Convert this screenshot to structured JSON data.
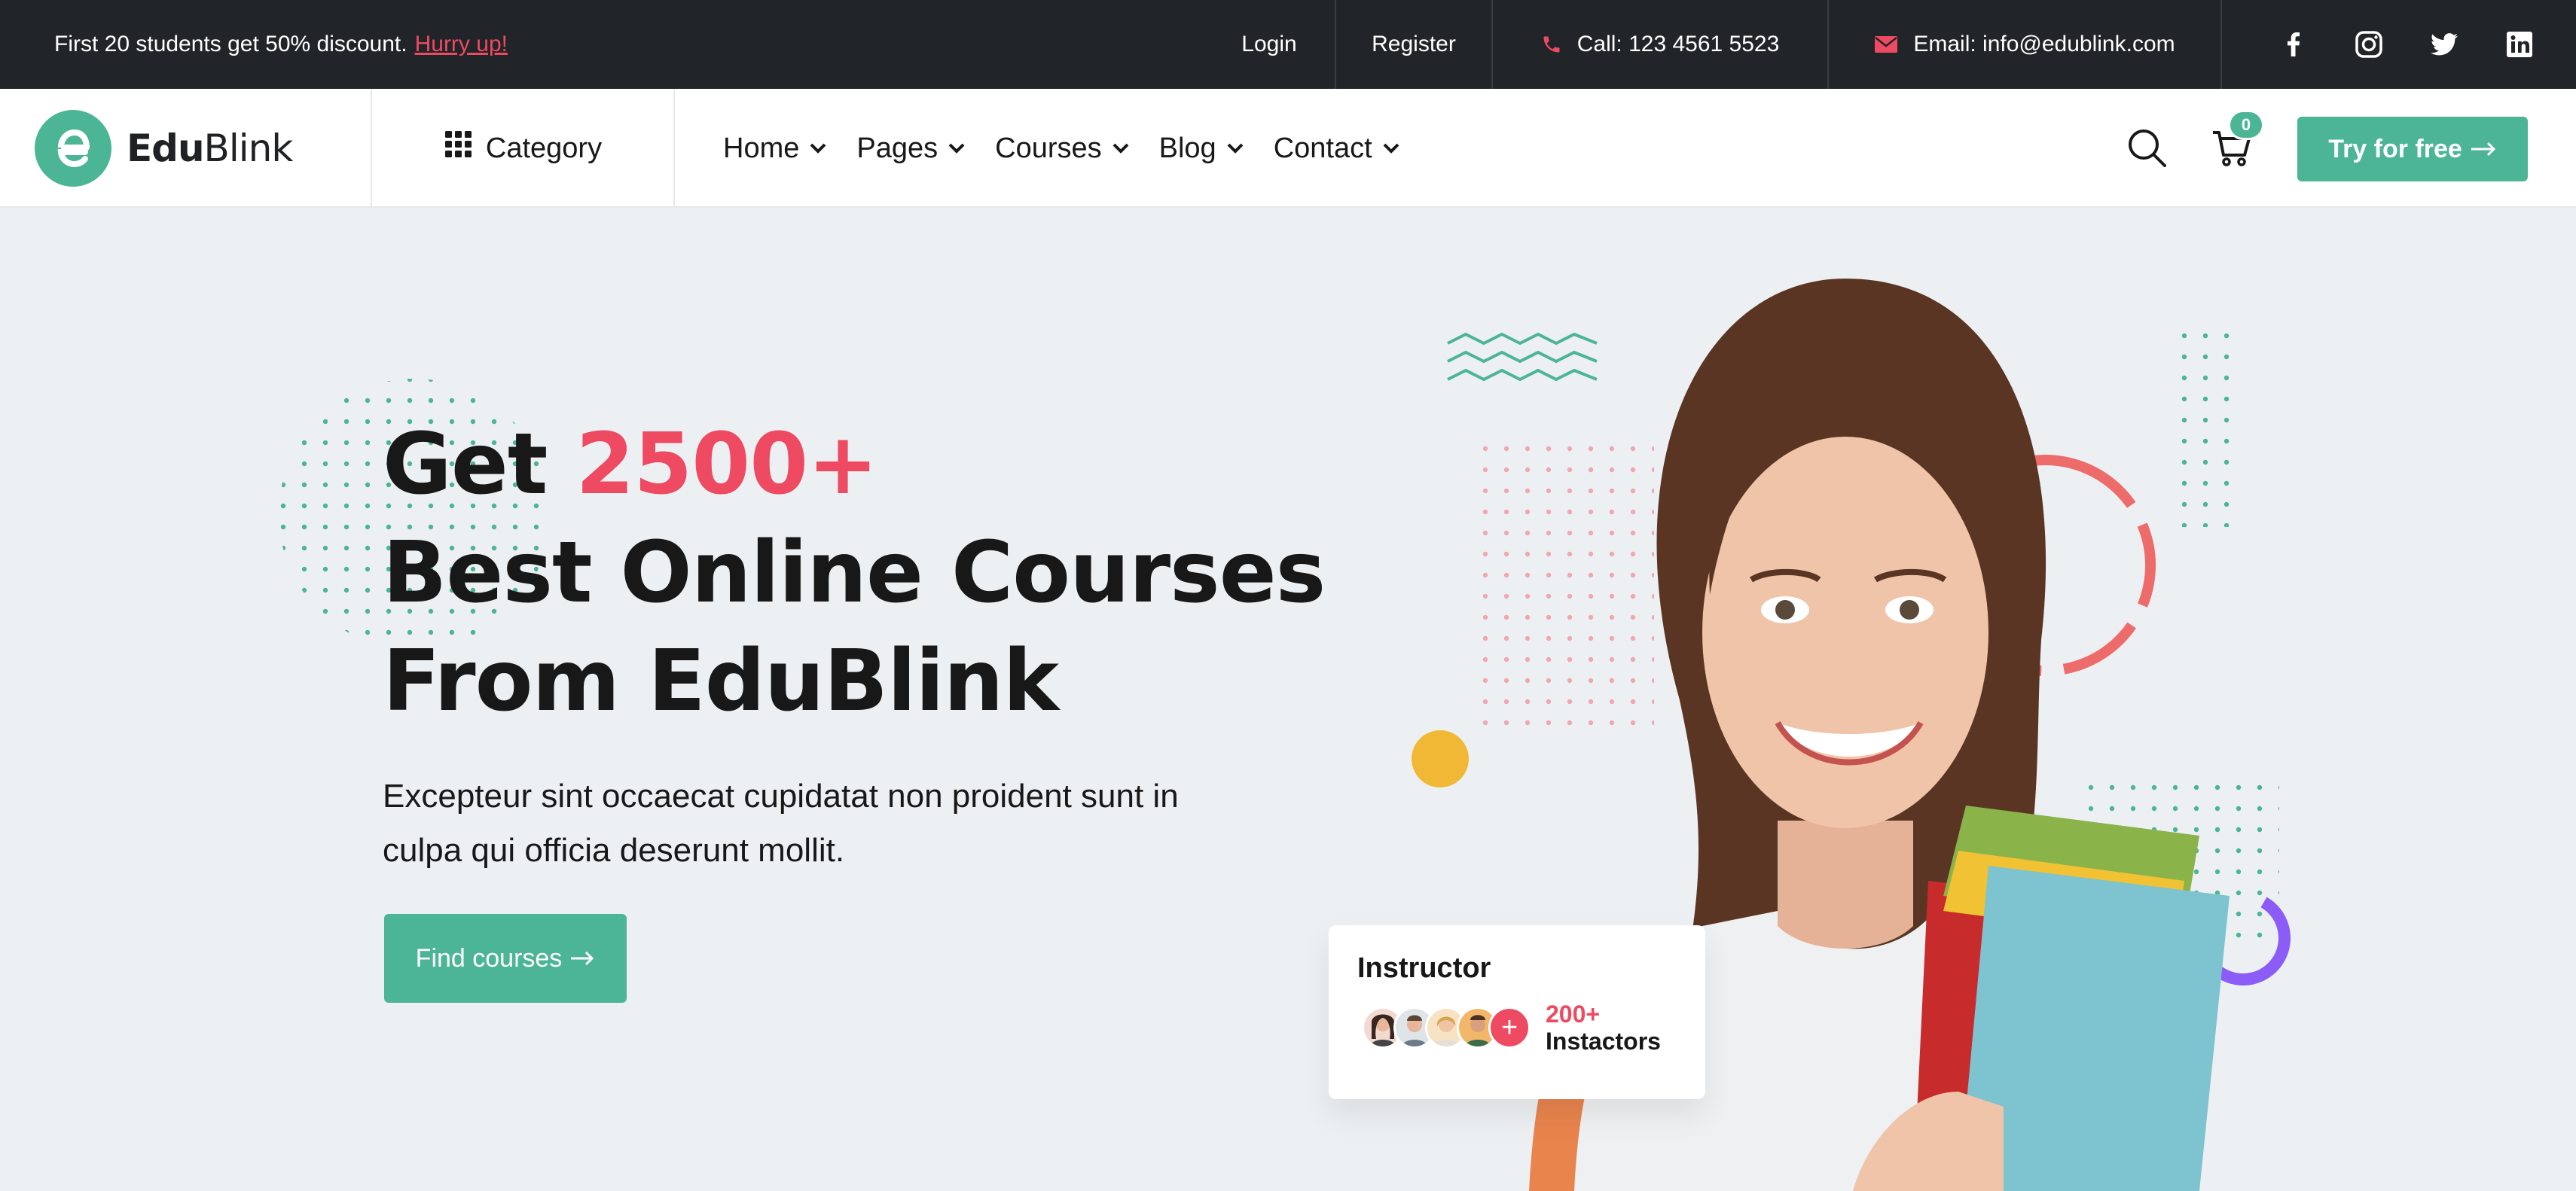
{
  "topbar": {
    "promo_text": "First 20 students get 50% discount.",
    "promo_link": "Hurry up!",
    "login": "Login",
    "register": "Register",
    "call": "Call: 123 4561 5523",
    "email": "Email: info@edublink.com",
    "social_icons": [
      "facebook-icon",
      "instagram-icon",
      "twitter-icon",
      "linkedin-icon"
    ]
  },
  "nav": {
    "logo_bold": "Edu",
    "logo_light": "Blink",
    "category": "Category",
    "menu": [
      {
        "label": "Home"
      },
      {
        "label": "Pages"
      },
      {
        "label": "Courses"
      },
      {
        "label": "Blog"
      },
      {
        "label": "Contact"
      }
    ],
    "cart_count": "0",
    "cta": "Try for free"
  },
  "hero": {
    "title_prefix": "Get ",
    "title_accent": "2500+",
    "title_line2": "Best Online Courses",
    "title_line3": "From EduBlink",
    "description": "Excepteur sint occaecat cupidatat non proident sunt in culpa qui officia deserunt mollit.",
    "button": "Find courses"
  },
  "instructor_card": {
    "title": "Instructor",
    "count": "200+",
    "label": "Instactors"
  },
  "colors": {
    "primary": "#4cb595",
    "accent": "#ee4a62",
    "dark": "#212428",
    "background": "#edf0f2",
    "yellow": "#f1b836",
    "purple": "#8b5cf6"
  }
}
